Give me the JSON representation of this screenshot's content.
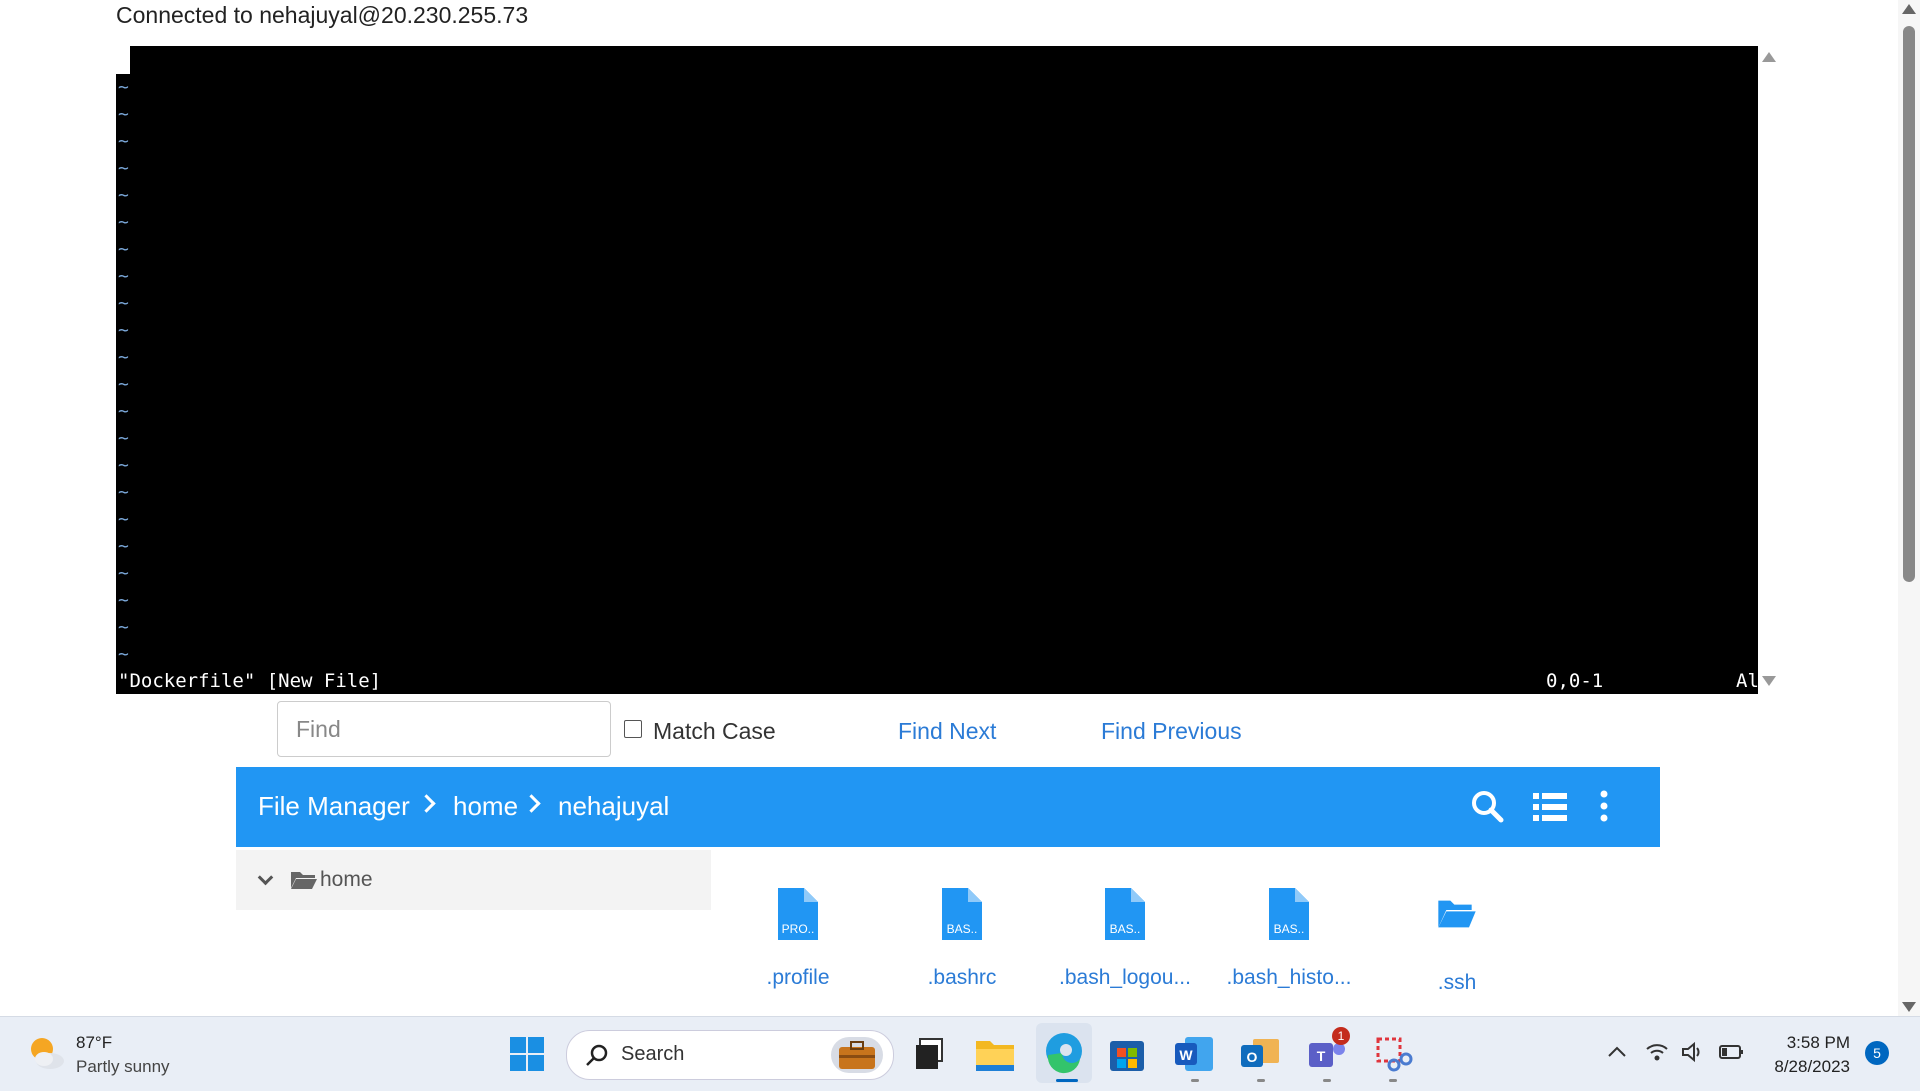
{
  "connection": {
    "text": "Connected to nehajuyal@20.230.255.73"
  },
  "terminal": {
    "tilde": "~",
    "status_left": "\"Dockerfile\" [New File]",
    "status_pos": "0,0-1",
    "status_all": "Al"
  },
  "find": {
    "placeholder": "Find",
    "match_case": "Match Case",
    "find_next": "Find Next",
    "find_previous": "Find Previous"
  },
  "file_manager": {
    "breadcrumb": [
      "File Manager",
      "home",
      "nehajuyal"
    ],
    "tree": {
      "label": "home"
    },
    "files": [
      {
        "name": ".profile",
        "ext": "PRO..",
        "type": "file"
      },
      {
        "name": ".bashrc",
        "ext": "BAS..",
        "type": "file"
      },
      {
        "name": ".bash_logou...",
        "ext": "BAS..",
        "type": "file"
      },
      {
        "name": ".bash_histo...",
        "ext": "BAS..",
        "type": "file"
      },
      {
        "name": ".ssh",
        "ext": "",
        "type": "folder"
      }
    ],
    "accent_color": "#2196f3"
  },
  "taskbar": {
    "weather": {
      "temp": "87°F",
      "desc": "Partly sunny"
    },
    "search_label": "Search",
    "clock": {
      "time": "3:58 PM",
      "date": "8/28/2023"
    },
    "notification_count": "5",
    "teams_badge": "1",
    "icons": [
      "windows-start-icon",
      "task-view-icon",
      "file-explorer-icon",
      "edge-icon",
      "microsoft-store-icon",
      "word-icon",
      "outlook-icon",
      "teams-icon",
      "snipping-tool-icon"
    ]
  }
}
